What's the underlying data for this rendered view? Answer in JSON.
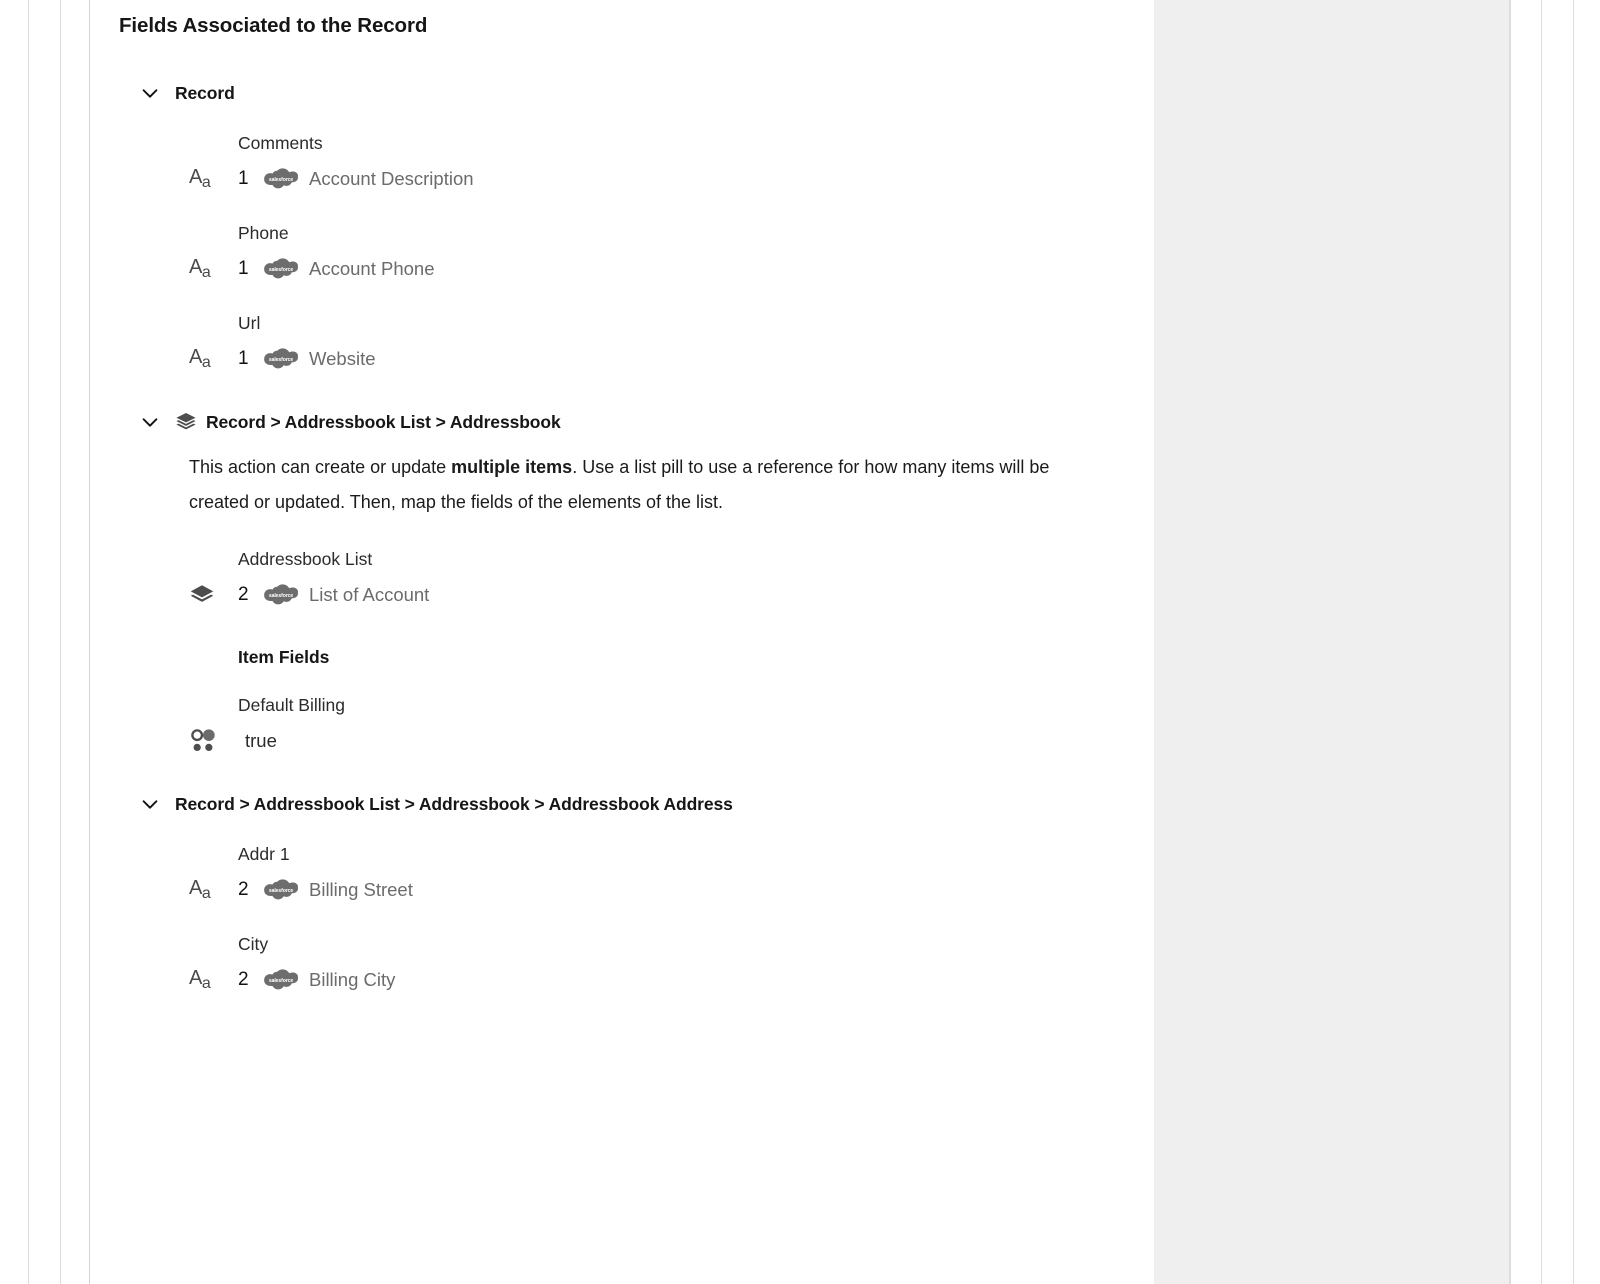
{
  "panel": {
    "title": "Fields Associated to the Record"
  },
  "icons": {
    "chevron": "chevron-down-icon",
    "layers": "layers-icon",
    "text_type": "text-type-icon",
    "boolean_type": "boolean-type-icon",
    "salesforce": "salesforce-cloud-icon",
    "salesforce_wordmark": "salesforce"
  },
  "sections": [
    {
      "id": "record",
      "title": "Record",
      "has_layers_icon": false,
      "description": null,
      "fields": [
        {
          "label": "Comments",
          "type_icon": "text",
          "count": "1",
          "source": "salesforce",
          "value": "Account Description"
        },
        {
          "label": "Phone",
          "type_icon": "text",
          "count": "1",
          "source": "salesforce",
          "value": "Account Phone"
        },
        {
          "label": "Url",
          "type_icon": "text",
          "count": "1",
          "source": "salesforce",
          "value": "Website"
        }
      ],
      "item_fields_heading": null,
      "item_fields": []
    },
    {
      "id": "record-addressbook-list-addressbook",
      "title": "Record > Addressbook List > Addressbook",
      "has_layers_icon": true,
      "description": {
        "part1": "This action can create or update ",
        "emphasis": "multiple items",
        "part2": ". Use a list pill to use a reference for how many items will be created or updated. Then, map the fields of the elements of the list."
      },
      "fields": [
        {
          "label": "Addressbook List",
          "type_icon": "layers",
          "count": "2",
          "source": "salesforce",
          "value": "List of Account"
        }
      ],
      "item_fields_heading": "Item Fields",
      "item_fields": [
        {
          "label": "Default Billing",
          "type_icon": "boolean",
          "count": null,
          "source": null,
          "value": "true"
        }
      ]
    },
    {
      "id": "record-addressbook-list-addressbook-address",
      "title": "Record > Addressbook List > Addressbook > Addressbook Address",
      "has_layers_icon": false,
      "description": null,
      "fields": [
        {
          "label": "Addr 1",
          "type_icon": "text",
          "count": "2",
          "source": "salesforce",
          "value": "Billing Street"
        },
        {
          "label": "City",
          "type_icon": "text",
          "count": "2",
          "source": "salesforce",
          "value": "Billing City"
        }
      ],
      "item_fields_heading": null,
      "item_fields": []
    }
  ],
  "colors": {
    "text_primary": "#161616",
    "text_secondary": "#2b2b2b",
    "value_gray": "#6b6b6b",
    "icon_gray": "#4a4a4a",
    "panel_gray": "#efefef",
    "rule": "#dedede"
  }
}
